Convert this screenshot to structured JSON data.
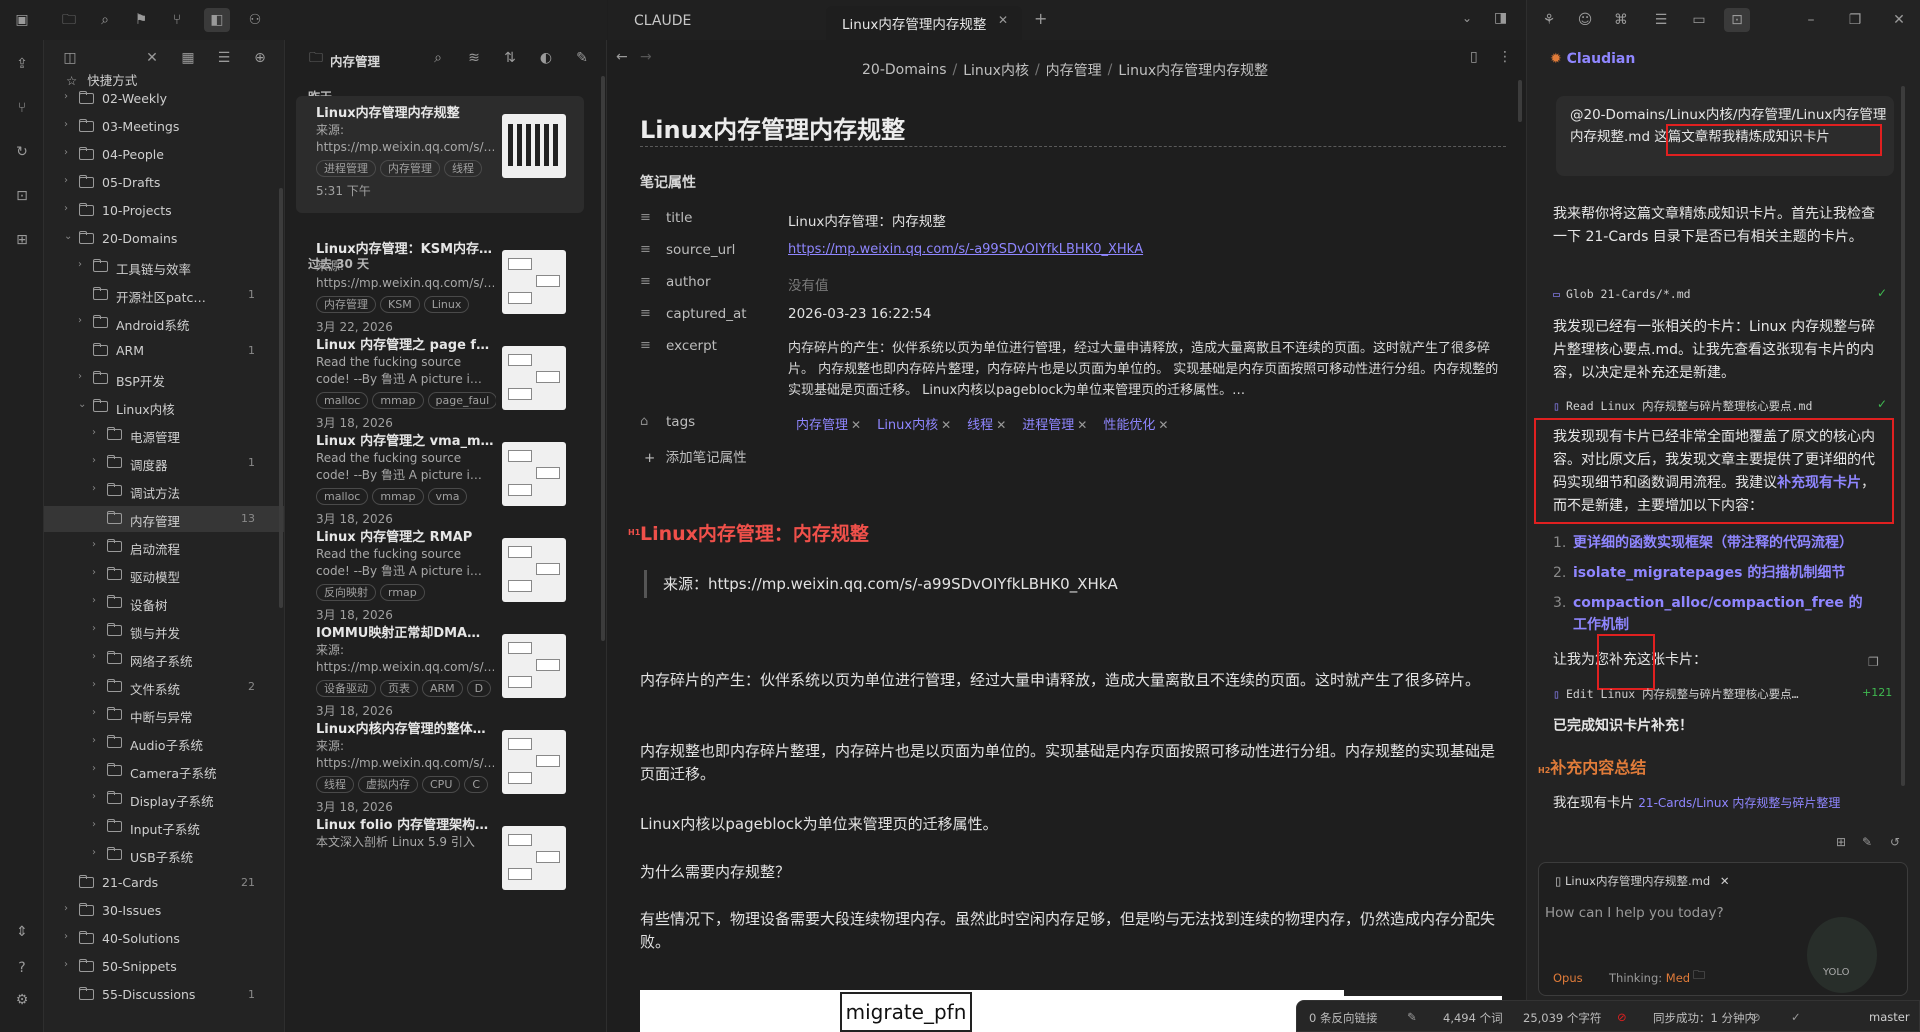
{
  "ribbon": {
    "icons": [
      "sidebar-toggle-icon",
      "folder-icon",
      "search-icon",
      "bookmark-icon",
      "git-branch-icon",
      "canvas-icon",
      "graph-icon",
      "publish-icon",
      "git-icon",
      "sync-icon",
      "robot-icon",
      "command-icon",
      "help-icon",
      "settings-icon"
    ]
  },
  "explorer": {
    "shortcuts_label": "快捷方式",
    "items": [
      {
        "label": "02-Weekly",
        "count": "",
        "indent": 1,
        "chev": "›"
      },
      {
        "label": "03-Meetings",
        "count": "",
        "indent": 1,
        "chev": "›"
      },
      {
        "label": "04-People",
        "count": "",
        "indent": 1,
        "chev": "›"
      },
      {
        "label": "05-Drafts",
        "count": "",
        "indent": 1,
        "chev": "›"
      },
      {
        "label": "10-Projects",
        "count": "",
        "indent": 1,
        "chev": "›"
      },
      {
        "label": "20-Domains",
        "count": "",
        "indent": 1,
        "chev": "⌄"
      },
      {
        "label": "工具链与效率",
        "count": "",
        "indent": 2,
        "chev": "›"
      },
      {
        "label": "开源社区patc…",
        "count": "1",
        "indent": 2,
        "chev": ""
      },
      {
        "label": "Android系统",
        "count": "",
        "indent": 2,
        "chev": "›"
      },
      {
        "label": "ARM",
        "count": "1",
        "indent": 2,
        "chev": ""
      },
      {
        "label": "BSP开发",
        "count": "",
        "indent": 2,
        "chev": "›"
      },
      {
        "label": "Linux内核",
        "count": "",
        "indent": 2,
        "chev": "⌄"
      },
      {
        "label": "电源管理",
        "count": "",
        "indent": 3,
        "chev": "›"
      },
      {
        "label": "调度器",
        "count": "1",
        "indent": 3,
        "chev": "›"
      },
      {
        "label": "调试方法",
        "count": "",
        "indent": 3,
        "chev": "›"
      },
      {
        "label": "内存管理",
        "count": "13",
        "indent": 3,
        "chev": "",
        "active": true
      },
      {
        "label": "启动流程",
        "count": "",
        "indent": 3,
        "chev": "›"
      },
      {
        "label": "驱动模型",
        "count": "",
        "indent": 3,
        "chev": "›"
      },
      {
        "label": "设备树",
        "count": "",
        "indent": 3,
        "chev": "›"
      },
      {
        "label": "锁与并发",
        "count": "",
        "indent": 3,
        "chev": "›"
      },
      {
        "label": "网络子系统",
        "count": "",
        "indent": 3,
        "chev": "›"
      },
      {
        "label": "文件系统",
        "count": "2",
        "indent": 3,
        "chev": "›"
      },
      {
        "label": "中断与异常",
        "count": "",
        "indent": 3,
        "chev": "›"
      },
      {
        "label": "Audio子系统",
        "count": "",
        "indent": 3,
        "chev": "›"
      },
      {
        "label": "Camera子系统",
        "count": "",
        "indent": 3,
        "chev": "›"
      },
      {
        "label": "Display子系统",
        "count": "",
        "indent": 3,
        "chev": "›"
      },
      {
        "label": "Input子系统",
        "count": "",
        "indent": 3,
        "chev": "›"
      },
      {
        "label": "USB子系统",
        "count": "",
        "indent": 3,
        "chev": "›"
      },
      {
        "label": "21-Cards",
        "count": "21",
        "indent": 1,
        "chev": ""
      },
      {
        "label": "30-Issues",
        "count": "",
        "indent": 1,
        "chev": "›"
      },
      {
        "label": "40-Solutions",
        "count": "",
        "indent": 1,
        "chev": "›"
      },
      {
        "label": "50-Snippets",
        "count": "",
        "indent": 1,
        "chev": "›"
      },
      {
        "label": "55-Discussions",
        "count": "1",
        "indent": 1,
        "chev": ""
      }
    ]
  },
  "notelist": {
    "folder": "内存管理",
    "group_yesterday": "昨天",
    "group_30days": "过去 30 天",
    "cards": [
      {
        "title": "Linux内存管理内存规整",
        "desc": "来源: https://mp.weixin.qq.com/s/…",
        "tags": [
          "进程管理",
          "内存管理",
          "线程"
        ],
        "date": "5:31 下午",
        "selected": true
      },
      {
        "title": "Linux内存管理：KSM内存…",
        "desc": "来源: https://mp.weixin.qq.com/s/…",
        "tags": [
          "内存管理",
          "KSM",
          "Linux"
        ],
        "date": "3月 22, 2026"
      },
      {
        "title": "Linux 内存管理之 page f…",
        "desc": "Read the fucking source code! --By 鲁迅 A picture i…",
        "tags": [
          "malloc",
          "mmap",
          "page_faul"
        ],
        "date": "3月 18, 2026"
      },
      {
        "title": "Linux 内存管理之 vma_m…",
        "desc": "Read the fucking source code! --By 鲁迅 A picture i…",
        "tags": [
          "malloc",
          "mmap",
          "vma"
        ],
        "date": "3月 18, 2026"
      },
      {
        "title": "Linux 内存管理之 RMAP",
        "desc": "Read the fucking source code! --By 鲁迅 A picture i…",
        "tags": [
          "反向映射",
          "rmap"
        ],
        "date": "3月 18, 2026"
      },
      {
        "title": "IOMMU映射正常却DMA…",
        "desc": "来源: https://mp.weixin.qq.com/s/…",
        "tags": [
          "设备驱动",
          "页表",
          "ARM",
          "D"
        ],
        "date": "3月 18, 2026"
      },
      {
        "title": "Linux内核内存管理的整体…",
        "desc": "来源: https://mp.weixin.qq.com/s/…",
        "tags": [
          "线程",
          "虚拟内存",
          "CPU",
          "C"
        ],
        "date": "3月 18, 2026"
      },
      {
        "title": "Linux folio 内存管理架构…",
        "desc": "本文深入剖析 Linux 5.9 引入",
        "tags": [],
        "date": ""
      }
    ]
  },
  "editor": {
    "pane_title": "CLAUDE",
    "tab_title": "Linux内存管理内存规整",
    "breadcrumb": [
      "20-Domains",
      "Linux内核",
      "内存管理",
      "Linux内存管理内存规整"
    ],
    "h1": "Linux内存管理内存规整",
    "props_label": "笔记属性",
    "props": [
      {
        "key": "title",
        "value": "Linux内存管理：内存规整"
      },
      {
        "key": "source_url",
        "value": "https://mp.weixin.qq.com/s/-a99SDvOIYfkLBHK0_XHkA"
      },
      {
        "key": "author",
        "value": "没有值"
      },
      {
        "key": "captured_at",
        "value": "2026-03-23 16:22:54"
      },
      {
        "key": "excerpt",
        "value": "内存碎片的产生：伙伴系统以页为单位进行管理，经过大量申请释放，造成大量离散且不连续的页面。这时就产生了很多碎片。 内存规整也即内存碎片整理，内存碎片也是以页面为单位的。 实现基础是内存页面按照可移动性进行分组。内存规整的实现基础是页面迁移。 Linux内核以pageblock为单位来管理页的迁移属性。…"
      }
    ],
    "tags_key": "tags",
    "tags": [
      "内存管理",
      "Linux内核",
      "线程",
      "进程管理",
      "性能优化"
    ],
    "add_prop": "添加笔记属性",
    "section_heading": "Linux内存管理：内存规整",
    "section_marker": "H1",
    "quote": "来源：https://mp.weixin.qq.com/s/-a99SDvOIYfkLBHK0_XHkA",
    "paragraphs": [
      "内存碎片的产生：伙伴系统以页为单位进行管理，经过大量申请释放，造成大量离散且不连续的页面。这时就产生了很多碎片。",
      "内存规整也即内存碎片整理，内存碎片也是以页面为单位的。实现基础是内存页面按照可移动性进行分组。内存规整的实现基础是页面迁移。",
      "Linux内核以pageblock为单位来管理页的迁移属性。",
      "为什么需要内存规整？",
      "有些情况下，物理设备需要大段连续物理内存。虽然此时空闲内存足够，但是哟与无法找到连续的物理内存，仍然造成内存分配失败。"
    ],
    "image_caption": "migrate_pfn"
  },
  "claudian": {
    "title": "Claudian",
    "user_msg": "@20-Domains/Linux内核/内存管理/Linux内存管理内存规整.md 这篇文章帮我精炼成知识卡片",
    "msg1": "我来帮你将这篇文章精炼成知识卡片。首先让我检查一下 21-Cards 目录下是否已有相关主题的卡片。",
    "tool1": "Glob 21-Cards/*.md",
    "msg2": "我发现已经有一张相关的卡片：Linux 内存规整与碎片整理核心要点.md。让我先查看这张现有卡片的内容，以决定是补充还是新建。",
    "tool2": "Read Linux 内存规整与碎片整理核心要点.md",
    "msg3a": "我发现现有卡片已经非常全面地覆盖了原文的核心内容。对比原文后，我发现文章主要提供了更详细的代码实现细节和函数调用流程。我建议",
    "msg3b": "补充现有卡片",
    "msg3c": "，而不是新建，主要增加以下内容：",
    "list": [
      "更详细的函数实现框架（带注释的代码流程）",
      "isolate_migratepages 的扫描机制细节",
      "compaction_alloc/compaction_free 的工作机制"
    ],
    "msg4": "让我为您补充这张卡片：",
    "tool3": "Edit Linux 内存规整与碎片整理核心要点…",
    "tool3_badge": "+121",
    "msg5": "已完成知识卡片补充！",
    "h2_marker": "H2",
    "h2": "补充内容总结",
    "msg6a": "我在现有卡片 ",
    "msg6b": "21-Cards/Linux 内存规整与碎片整理",
    "context_file": "Linux内存管理内存规整.md",
    "placeholder": "How can I help you today?",
    "model": "Opus",
    "thinking_label": "Thinking:",
    "thinking_value": "Med",
    "yolo": "YOLO"
  },
  "statusbar": {
    "backlinks": "0 条反向链接",
    "words": "4,494 个词",
    "chars": "25,039 个字符",
    "sync": "同步成功：1 分钟内",
    "branch": "master"
  },
  "colors": {
    "accent": "#8f86ff",
    "heading_red": "#f0504a",
    "annotation_red": "#e02020",
    "background": "#1e1e1e"
  }
}
